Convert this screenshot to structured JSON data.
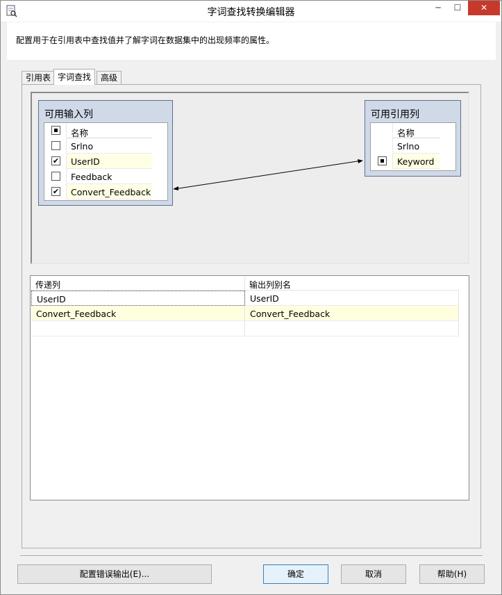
{
  "window": {
    "title": "字词查找转换编辑器",
    "minimize": "─",
    "maximize": "☐",
    "close": "✕"
  },
  "description": "配置用于在引用表中查找值并了解字词在数据集中的出现频率的属性。",
  "tabs": [
    {
      "label": "引用表",
      "active": false
    },
    {
      "label": "字词查找",
      "active": true
    },
    {
      "label": "高级",
      "active": false
    }
  ],
  "input_columns": {
    "title": "可用输入列",
    "header_label": "名称",
    "rows": [
      {
        "name": "Srlno",
        "checked": false
      },
      {
        "name": "UserID",
        "checked": true
      },
      {
        "name": "Feedback",
        "checked": false
      },
      {
        "name": "Convert_Feedback",
        "checked": true
      }
    ]
  },
  "reference_columns": {
    "title": "可用引用列",
    "header_label": "名称",
    "rows": [
      {
        "name": "Srlno",
        "checked": false
      },
      {
        "name": "Keyword",
        "checked": true
      }
    ]
  },
  "mapping_link": {
    "from": "Convert_Feedback",
    "to": "Keyword"
  },
  "passthrough_grid": {
    "headers": [
      "传递列",
      "输出列别名"
    ],
    "rows": [
      {
        "input": "UserID",
        "alias": "UserID"
      },
      {
        "input": "Convert_Feedback",
        "alias": "Convert_Feedback"
      }
    ]
  },
  "buttons": {
    "config_error": "配置错误输出(E)...",
    "ok": "确定",
    "cancel": "取消",
    "help": "帮助(H)"
  },
  "colors": {
    "box_fill": "#cfd9e8",
    "highlight": "#ffffe5",
    "close_red": "#c7392c"
  }
}
